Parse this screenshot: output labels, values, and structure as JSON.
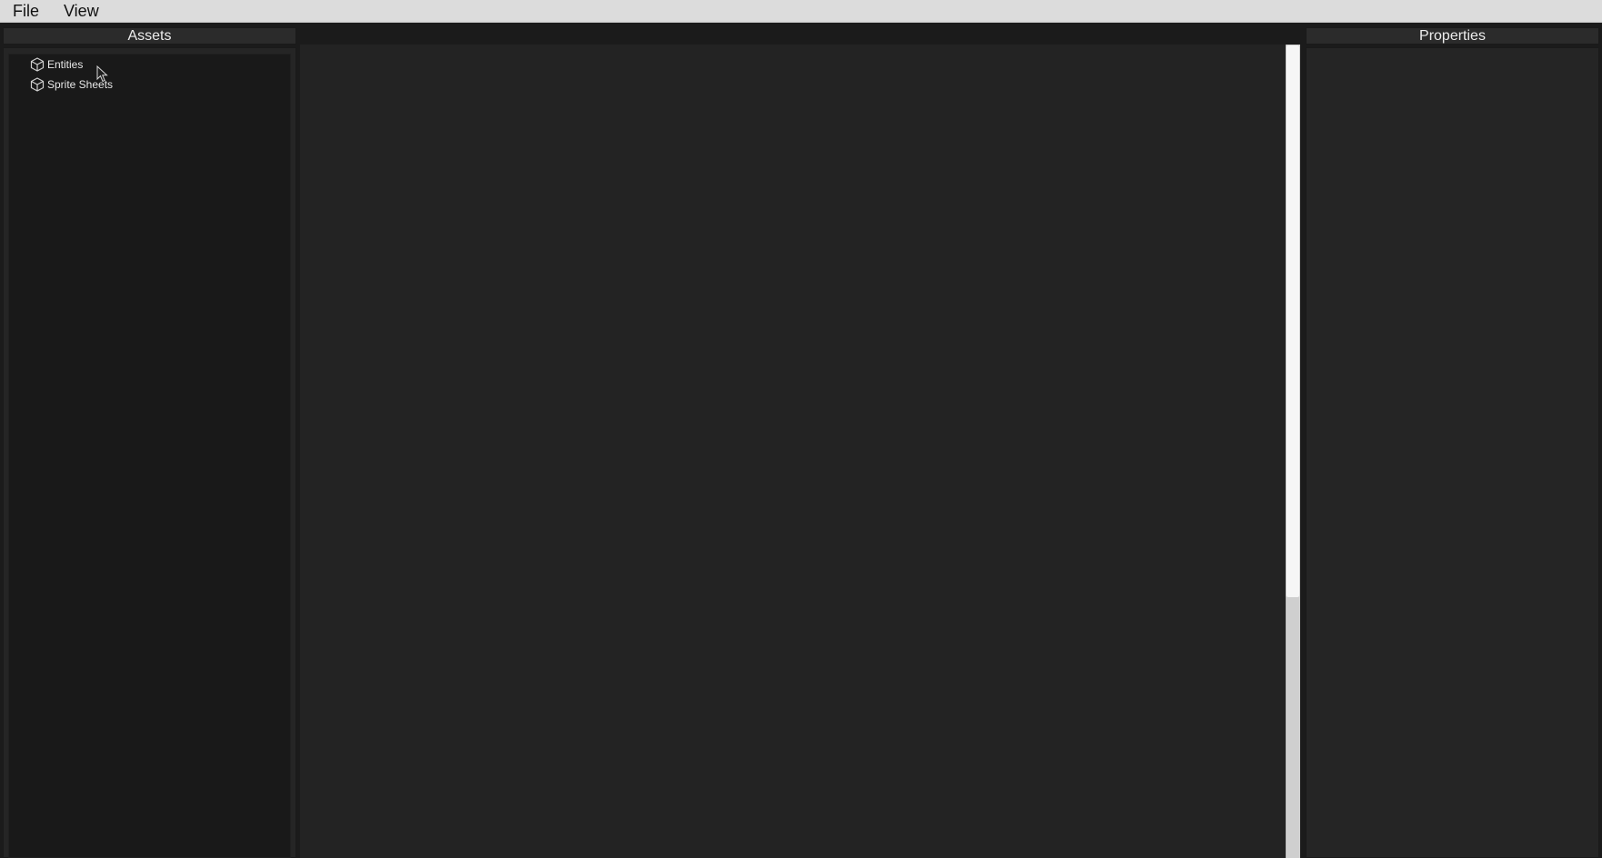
{
  "menubar": {
    "items": [
      {
        "label": "File"
      },
      {
        "label": "View"
      }
    ]
  },
  "assets_panel": {
    "title": "Assets",
    "tree": [
      {
        "label": "Entities",
        "icon": "cube-icon"
      },
      {
        "label": "Sprite Sheets",
        "icon": "cube-icon"
      }
    ]
  },
  "properties_panel": {
    "title": "Properties"
  },
  "colors": {
    "menubar_bg": "#dcdcdc",
    "panel_bg": "#252525",
    "viewport_bg": "#232323",
    "scrollbar_thumb": "#f6f6f6"
  },
  "viewport": {
    "scroll_thumb_fraction": 0.68
  }
}
